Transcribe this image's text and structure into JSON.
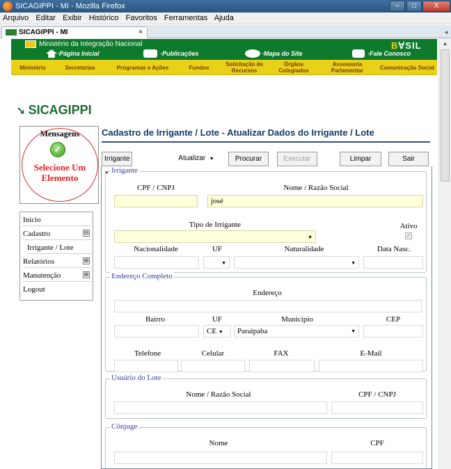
{
  "window": {
    "title": "SICAGIPPI - MI - Mozilla Firefox",
    "min": "‒",
    "max": "□",
    "close": "X"
  },
  "menu": [
    "Arquivo",
    "Editar",
    "Exibir",
    "Histórico",
    "Favoritos",
    "Ferramentas",
    "Ajuda"
  ],
  "tab": {
    "label": "SICAGIPPI - MI",
    "close": "×"
  },
  "site": {
    "ministry": "Ministério da Integração Nacional",
    "brand_left": "B",
    "brand_right": "SIL",
    "top_links": [
      "·Página Inicial",
      "·Publicações",
      "·Mapa do Site",
      "·Fale Conosco"
    ],
    "nav": [
      "Ministério",
      "Secretarias",
      "Programas e Ações",
      "Fundos",
      "Solicitação de Recursos",
      "Órgãos Colegiados",
      "Assessoria Parlamentar",
      "Comunicação Social"
    ]
  },
  "app": {
    "logo": "SICAGIPPI"
  },
  "messages": {
    "title": "Mensagens",
    "text": "Selecione Um Elemento"
  },
  "sidemenu": {
    "inicio": "Início",
    "cadastro": "Cadastro",
    "irrigante_lote": "Irrigante / Lote",
    "relatorios": "Relatórios",
    "manutencao": "Manutenção",
    "logout": "Logout",
    "collapse": "⊟",
    "expand": "⊞"
  },
  "heading": "Cadastro de Irrigante / Lote - Atualizar Dados do Irrigante / Lote",
  "toolbar": {
    "entity": "Irrigante",
    "action": "Atualizar",
    "procurar": "Procurar",
    "executar": "Executar",
    "limpar": "Limpar",
    "sair": "Sair"
  },
  "irrigante": {
    "legend": "Irrigante",
    "cpf_label": "CPF / CNPJ",
    "cpf_value": "",
    "nome_label": "Nome / Razão Social",
    "nome_value": "josé",
    "tipo_label": "Tipo de Irrigante",
    "ativo_label": "Ativo",
    "ativo_checked": true,
    "nacionalidade_label": "Nacionalidade",
    "uf_label": "UF",
    "naturalidade_label": "Naturalidade",
    "data_nasc_label": "Data Nasc."
  },
  "endereco": {
    "legend": "Endereço Completo",
    "endereco_label": "Endereço",
    "bairro_label": "Bairro",
    "uf_label": "UF",
    "uf_value": "CE",
    "municipio_label": "Município",
    "municipio_value": "Paraipaba",
    "cep_label": "CEP",
    "telefone_label": "Telefone",
    "celular_label": "Celular",
    "fax_label": "FAX",
    "email_label": "E-Mail"
  },
  "usuario": {
    "legend": "Usuário do Lote",
    "nome_label": "Nome / Razão Social",
    "cpf_label": "CPF / CNPJ"
  },
  "conjuge": {
    "legend": "Cônjuge",
    "nome_label": "Nome",
    "cpf_label": "CPF"
  },
  "colors": {
    "accent": "#123a6e",
    "green": "#0e7a2c",
    "yellow": "#e9d11a",
    "alert": "#e32020"
  }
}
